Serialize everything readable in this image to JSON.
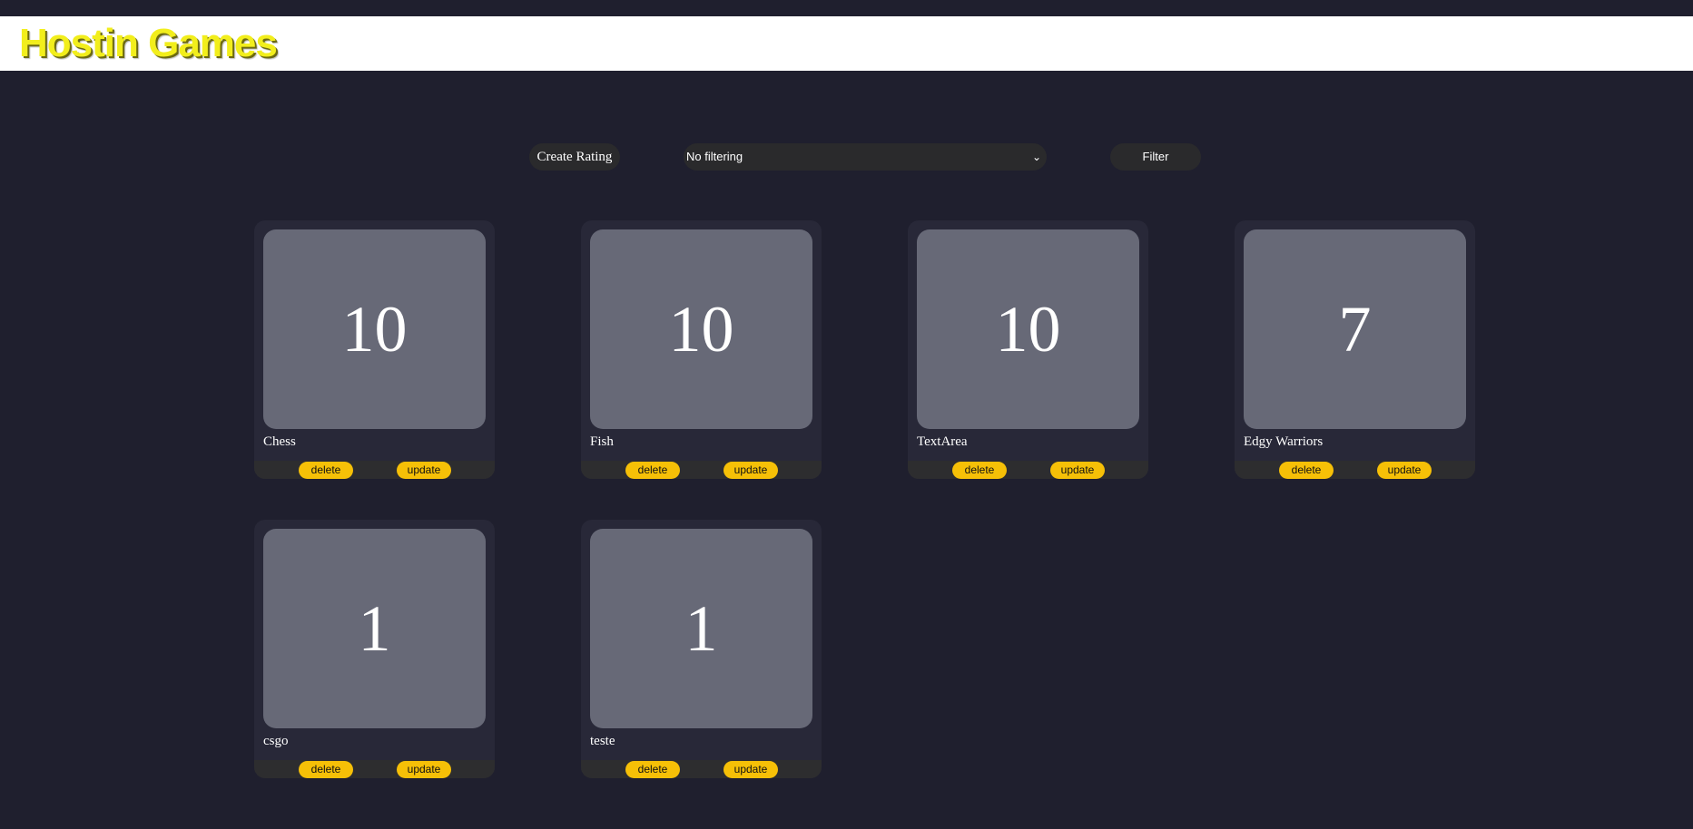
{
  "header": {
    "brand": "Hostin Games"
  },
  "controls": {
    "create_label": "Create Rating",
    "filter_selected": "No filtering",
    "filter_button_label": "Filter"
  },
  "cards": [
    {
      "score": "10",
      "name": "Chess",
      "delete_label": "delete",
      "update_label": "update"
    },
    {
      "score": "10",
      "name": "Fish",
      "delete_label": "delete",
      "update_label": "update"
    },
    {
      "score": "10",
      "name": "TextArea",
      "delete_label": "delete",
      "update_label": "update"
    },
    {
      "score": "7",
      "name": "Edgy Warriors",
      "delete_label": "delete",
      "update_label": "update"
    },
    {
      "score": "1",
      "name": "csgo",
      "delete_label": "delete",
      "update_label": "update"
    },
    {
      "score": "1",
      "name": "teste",
      "delete_label": "delete",
      "update_label": "update"
    }
  ],
  "colors": {
    "background": "#1f1f2e",
    "brand": "#f2ee1c",
    "card": "#282838",
    "score_box": "#676977",
    "action_pill": "#f6c007"
  }
}
